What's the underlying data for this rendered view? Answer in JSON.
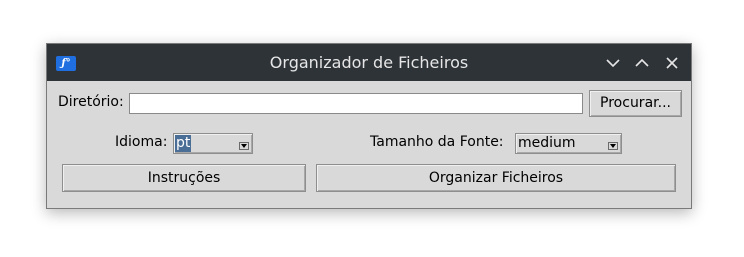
{
  "window": {
    "title": "Organizador de Ficheiros",
    "app_icon_glyph": "ƒ°"
  },
  "titlebar_buttons": {
    "minimize": "chevron-down-icon",
    "maximize": "chevron-up-icon",
    "close": "close-icon"
  },
  "directory": {
    "label": "Diretório:",
    "value": "",
    "browse_label": "Procurar..."
  },
  "language": {
    "label": "Idioma:",
    "selected": "pt"
  },
  "font_size": {
    "label": "Tamanho da Fonte:",
    "selected": "medium"
  },
  "actions": {
    "instructions_label": "Instruções",
    "organize_label": "Organizar Ficheiros"
  },
  "colors": {
    "titlebar": "#2e3338",
    "window_bg": "#d9d9d9",
    "selection": "#4b6e96",
    "app_icon": "#1f6fe0"
  }
}
